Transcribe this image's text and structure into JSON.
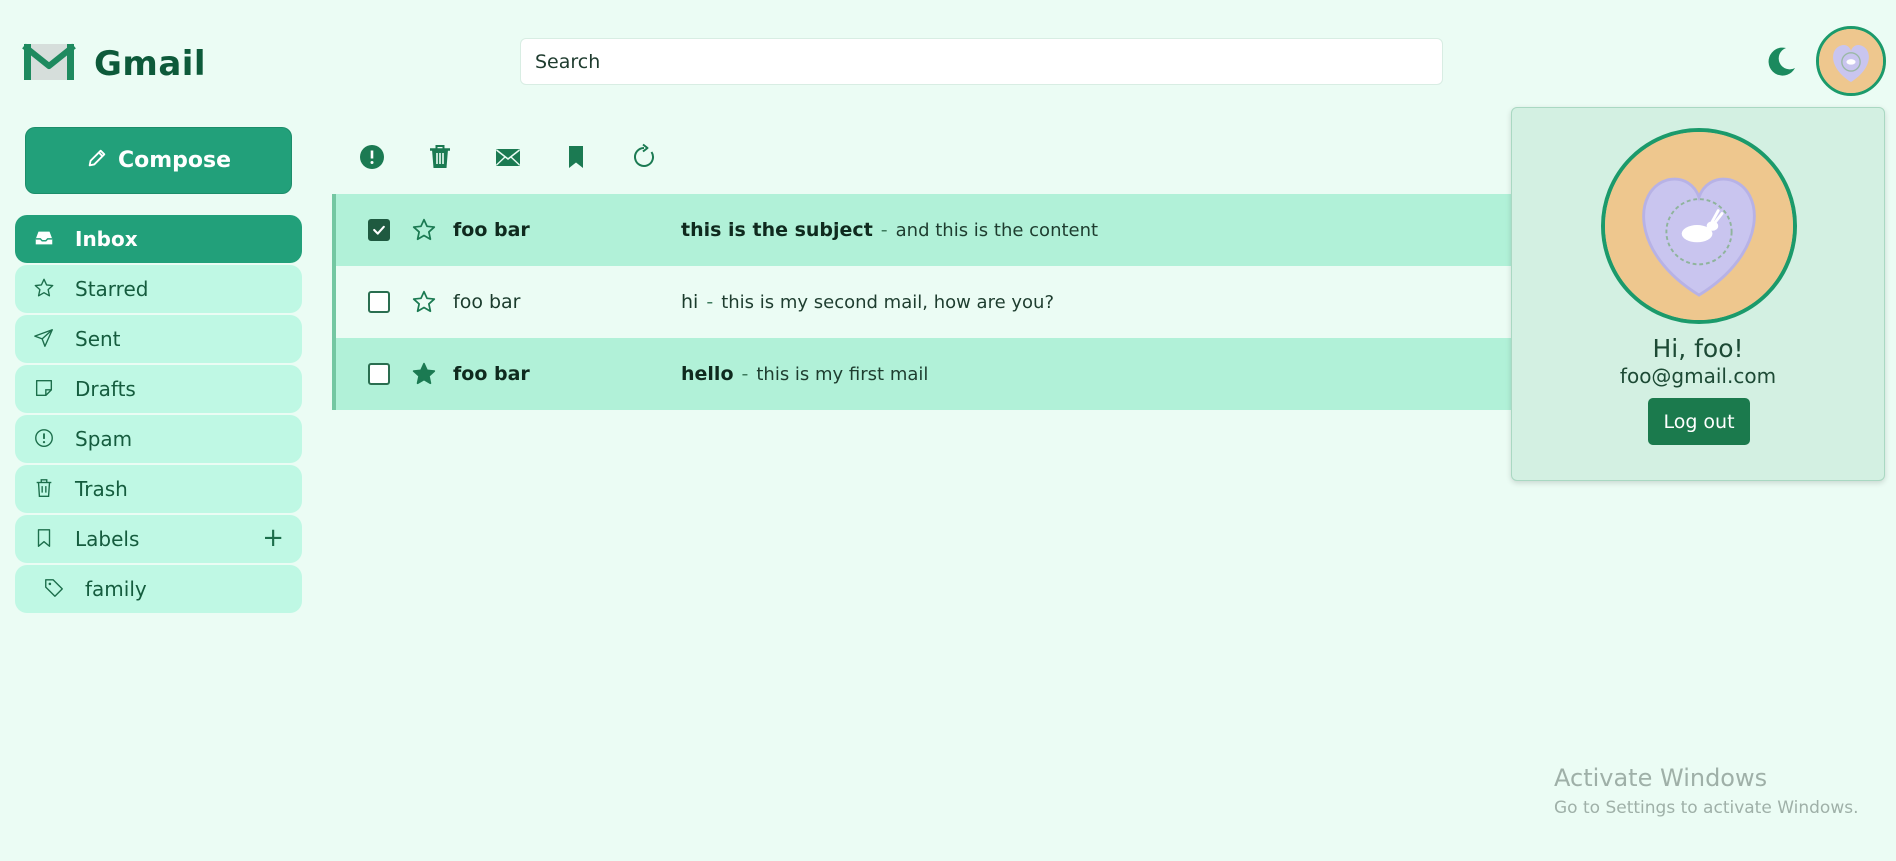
{
  "header": {
    "app_name": "Gmail",
    "search_placeholder": "Search",
    "logo_icon": "gmail-envelope-icon",
    "theme_icon": "moon-icon"
  },
  "sidebar": {
    "compose_label": "Compose",
    "items": [
      {
        "label": "Inbox",
        "icon": "inbox-icon",
        "active": true
      },
      {
        "label": "Starred",
        "icon": "star-icon"
      },
      {
        "label": "Sent",
        "icon": "send-icon"
      },
      {
        "label": "Drafts",
        "icon": "draft-icon"
      },
      {
        "label": "Spam",
        "icon": "alert-icon"
      },
      {
        "label": "Trash",
        "icon": "trash-icon"
      },
      {
        "label": "Labels",
        "icon": "bookmark-icon",
        "action": "+"
      },
      {
        "label": "family",
        "icon": "tag-icon"
      }
    ]
  },
  "toolbar": {
    "icons": [
      "spam-icon",
      "trash-icon",
      "mark-read-icon",
      "label-icon",
      "refresh-icon"
    ]
  },
  "mails": [
    {
      "sender": "foo bar",
      "subject": "this is the subject",
      "separator": "-",
      "snippet": "and this is the content",
      "checked": true,
      "starred": false,
      "unread": true
    },
    {
      "sender": "foo bar",
      "subject": "hi",
      "separator": "-",
      "snippet": "this is my second mail, how are you?",
      "checked": false,
      "starred": false,
      "unread": false
    },
    {
      "sender": "foo bar",
      "subject": "hello",
      "separator": "-",
      "snippet": "this is my first mail",
      "checked": false,
      "starred": true,
      "unread": true
    }
  ],
  "profile": {
    "greeting": "Hi, foo!",
    "email": "foo@gmail.com",
    "logout_label": "Log out"
  },
  "watermark": {
    "title": "Activate Windows",
    "subtitle": "Go to Settings to activate Windows."
  },
  "colors": {
    "background": "#ebfcf4",
    "accent": "#22a07a",
    "nav_bg": "#bff8e4",
    "unread_row": "#b1f1d8",
    "logout_button": "#1b7a4d"
  }
}
